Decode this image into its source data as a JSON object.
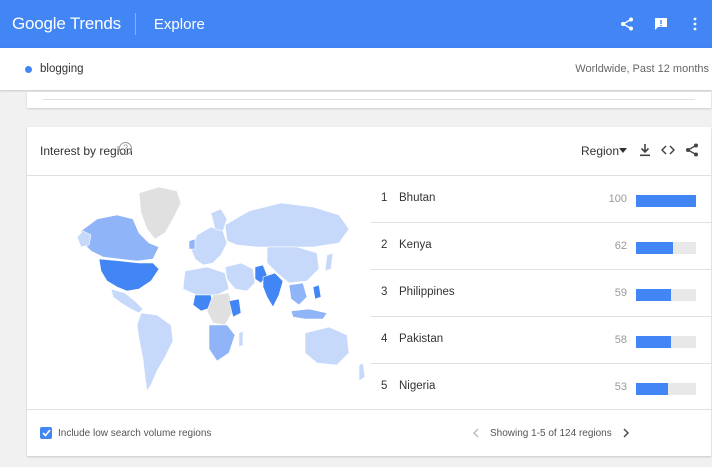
{
  "header": {
    "logo": "Google Trends",
    "section": "Explore",
    "icons": [
      "share-icon",
      "feedback-icon"
    ]
  },
  "term_bar": {
    "term": "blogging",
    "scope": "Worldwide, Past 12 months"
  },
  "region_card": {
    "title": "Interest by region",
    "help": "?",
    "resolution": "Region",
    "icons": [
      "download-icon",
      "embed-icon",
      "share-icon"
    ],
    "rows": [
      {
        "rank": "1",
        "name": "Bhutan",
        "value": 100
      },
      {
        "rank": "2",
        "name": "Kenya",
        "value": 62
      },
      {
        "rank": "3",
        "name": "Philippines",
        "value": 59
      },
      {
        "rank": "4",
        "name": "Pakistan",
        "value": 58
      },
      {
        "rank": "5",
        "name": "Nigeria",
        "value": 53
      }
    ],
    "include_low_volume_label": "Include low search volume regions",
    "include_low_volume_checked": true,
    "pagination": "Showing 1-5 of 124 regions"
  },
  "colors": {
    "brand": "#4285f4",
    "map_high": "#4285f4",
    "map_mid": "#8fb4f8",
    "map_low": "#c6d9fb",
    "map_none": "#e0e0e0"
  }
}
